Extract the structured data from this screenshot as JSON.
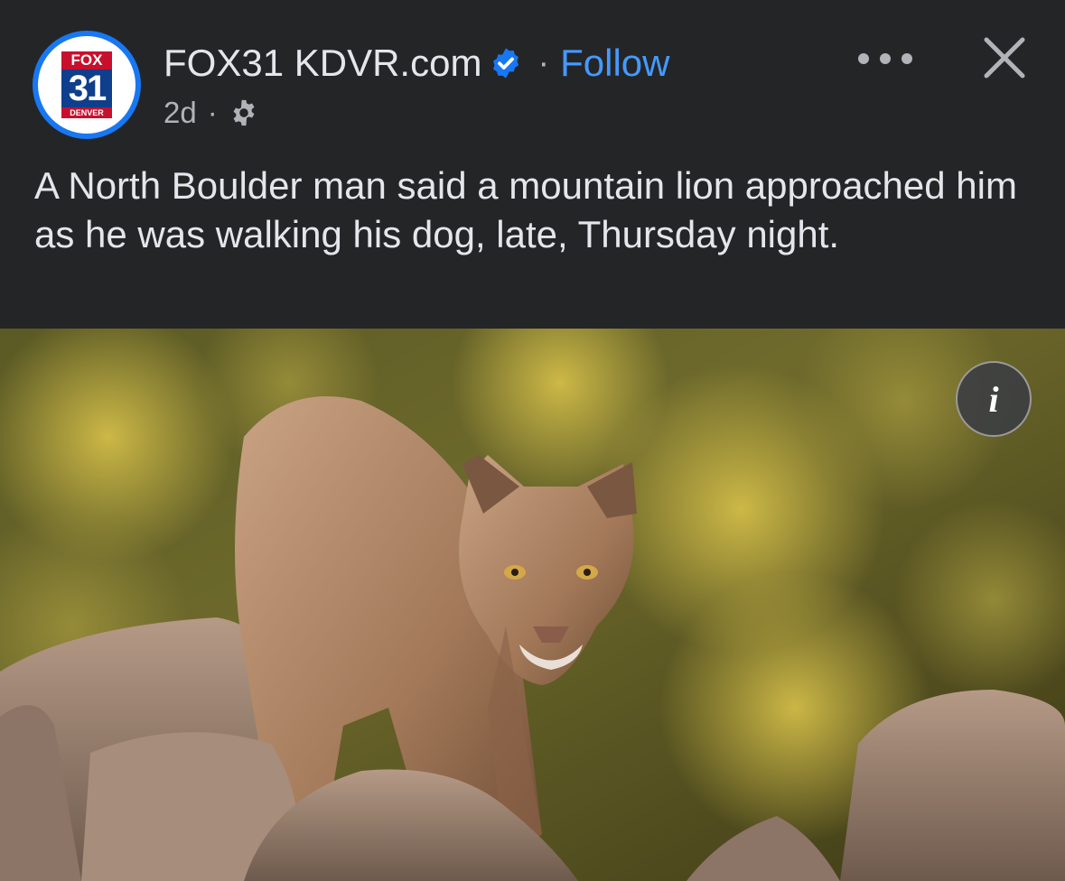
{
  "post": {
    "author": {
      "name": "FOX31 KDVR.com",
      "verified": true,
      "avatar_logo": {
        "top": "FOX",
        "number": "31",
        "city": "DENVER"
      }
    },
    "separator": "·",
    "follow_label": "Follow",
    "time": "2d",
    "meta_separator": "·",
    "privacy_icon": "gear-icon",
    "caption": "A North Boulder man said a mountain lion approached him as he was walking his dog, late, Thursday night.",
    "photo": {
      "subject": "mountain-lion",
      "info_label": "i"
    }
  },
  "colors": {
    "background": "#242526",
    "text": "#e4e6eb",
    "secondary_text": "#b0b3b8",
    "link": "#4599ff",
    "verified_badge": "#1877f2",
    "avatar_ring": "#1877f2"
  },
  "icons": {
    "more": "more-horizontal-icon",
    "close": "close-icon",
    "verified": "verified-badge-icon",
    "info": "info-icon"
  }
}
